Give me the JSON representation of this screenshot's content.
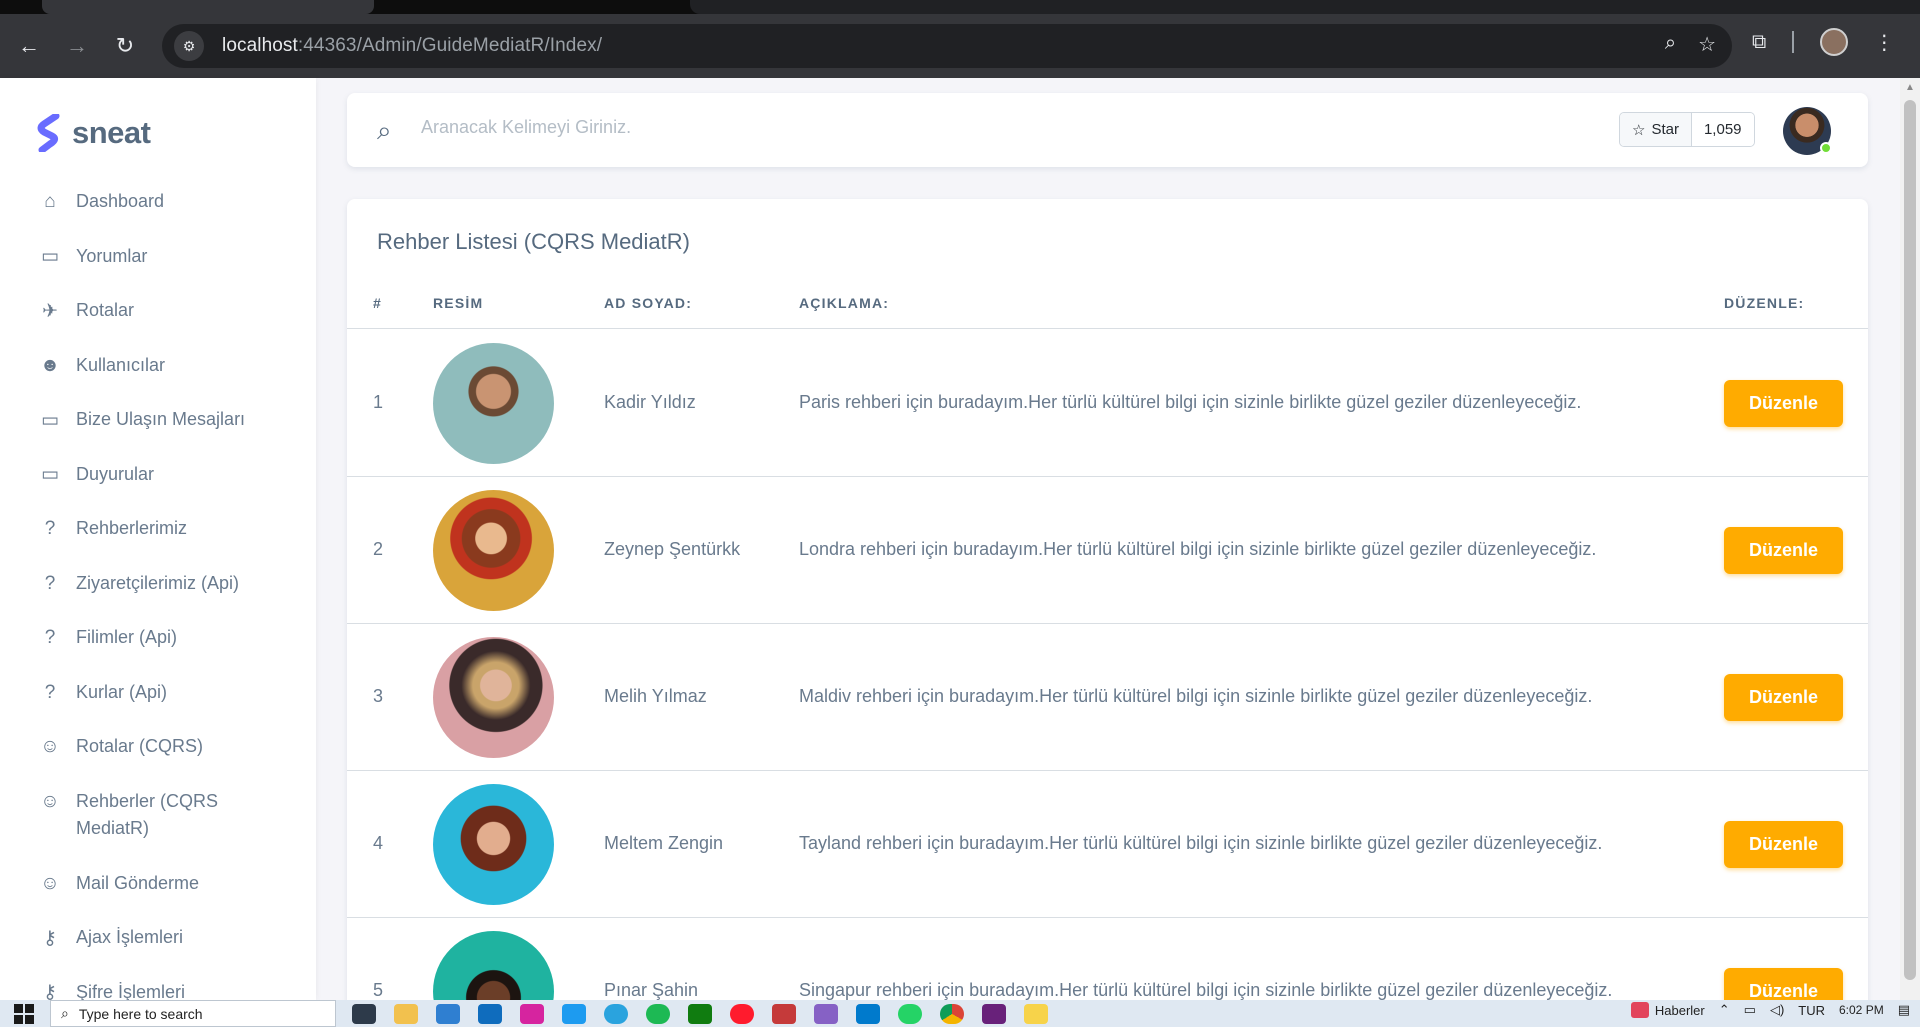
{
  "browser": {
    "url_host": "localhost",
    "url_rest": ":44363/Admin/GuideMediatR/Index/"
  },
  "brand": {
    "name": "sneat",
    "color": "#696cff"
  },
  "sidebar": {
    "items": [
      {
        "label": "Dashboard",
        "icon": "home-icon"
      },
      {
        "label": "Yorumlar",
        "icon": "comment-icon"
      },
      {
        "label": "Rotalar",
        "icon": "plane-icon"
      },
      {
        "label": "Kullanıcılar",
        "icon": "user-face-icon"
      },
      {
        "label": "Bize Ulaşın Mesajları",
        "icon": "message-icon"
      },
      {
        "label": "Duyurular",
        "icon": "message-icon"
      },
      {
        "label": "Rehberlerimiz",
        "icon": "help-circle-icon"
      },
      {
        "label": "Ziyaretçilerimiz (Api)",
        "icon": "help-circle-icon"
      },
      {
        "label": "Filimler (Api)",
        "icon": "help-circle-icon"
      },
      {
        "label": "Kurlar (Api)",
        "icon": "help-circle-icon"
      },
      {
        "label": "Rotalar (CQRS)",
        "icon": "mailchimp-icon"
      },
      {
        "label": "Rehberler (CQRS MediatR)",
        "icon": "mailchimp-icon"
      },
      {
        "label": "Mail Gönderme",
        "icon": "mailchimp-icon"
      },
      {
        "label": "Ajax İşlemleri",
        "icon": "key-icon"
      },
      {
        "label": "Şifre İşlemleri",
        "icon": "key-icon"
      }
    ]
  },
  "navbar": {
    "search_placeholder": "Aranacak Kelimeyi Giriniz.",
    "star_label": "Star",
    "star_count": "1,059"
  },
  "card": {
    "title": "Rehber Listesi (CQRS MediatR)",
    "columns": [
      "#",
      "RESİM",
      "AD SOYAD:",
      "AÇIKLAMA:",
      "DÜZENLE:"
    ],
    "rows": [
      {
        "num": "1",
        "name": "Kadir Yıldız",
        "desc": "Paris rehberi için buradayım.Her türlü kültürel bilgi için sizinle birlikte güzel geziler düzenleyeceğiz.",
        "btn": "Düzenle"
      },
      {
        "num": "2",
        "name": "Zeynep Şentürkk",
        "desc": "Londra rehberi için buradayım.Her türlü kültürel bilgi için sizinle birlikte güzel geziler düzenleyeceğiz.",
        "btn": "Düzenle"
      },
      {
        "num": "3",
        "name": "Melih Yılmaz",
        "desc": "Maldiv rehberi için buradayım.Her türlü kültürel bilgi için sizinle birlikte güzel geziler düzenleyeceğiz.",
        "btn": "Düzenle"
      },
      {
        "num": "4",
        "name": "Meltem Zengin",
        "desc": "Tayland rehberi için buradayım.Her türlü kültürel bilgi için sizinle birlikte güzel geziler düzenleyeceğiz.",
        "btn": "Düzenle"
      },
      {
        "num": "5",
        "name": "Pınar Şahin",
        "desc": "Singapur rehberi için buradayım.Her türlü kültürel bilgi için sizinle birlikte güzel geziler düzenleyeceğiz.",
        "btn": "Düzenle"
      }
    ],
    "button_color": "#ffab00"
  },
  "taskbar": {
    "search_placeholder": "Type here to search",
    "news_label": "Haberler",
    "lang": "TUR",
    "time": "6:02 PM"
  }
}
